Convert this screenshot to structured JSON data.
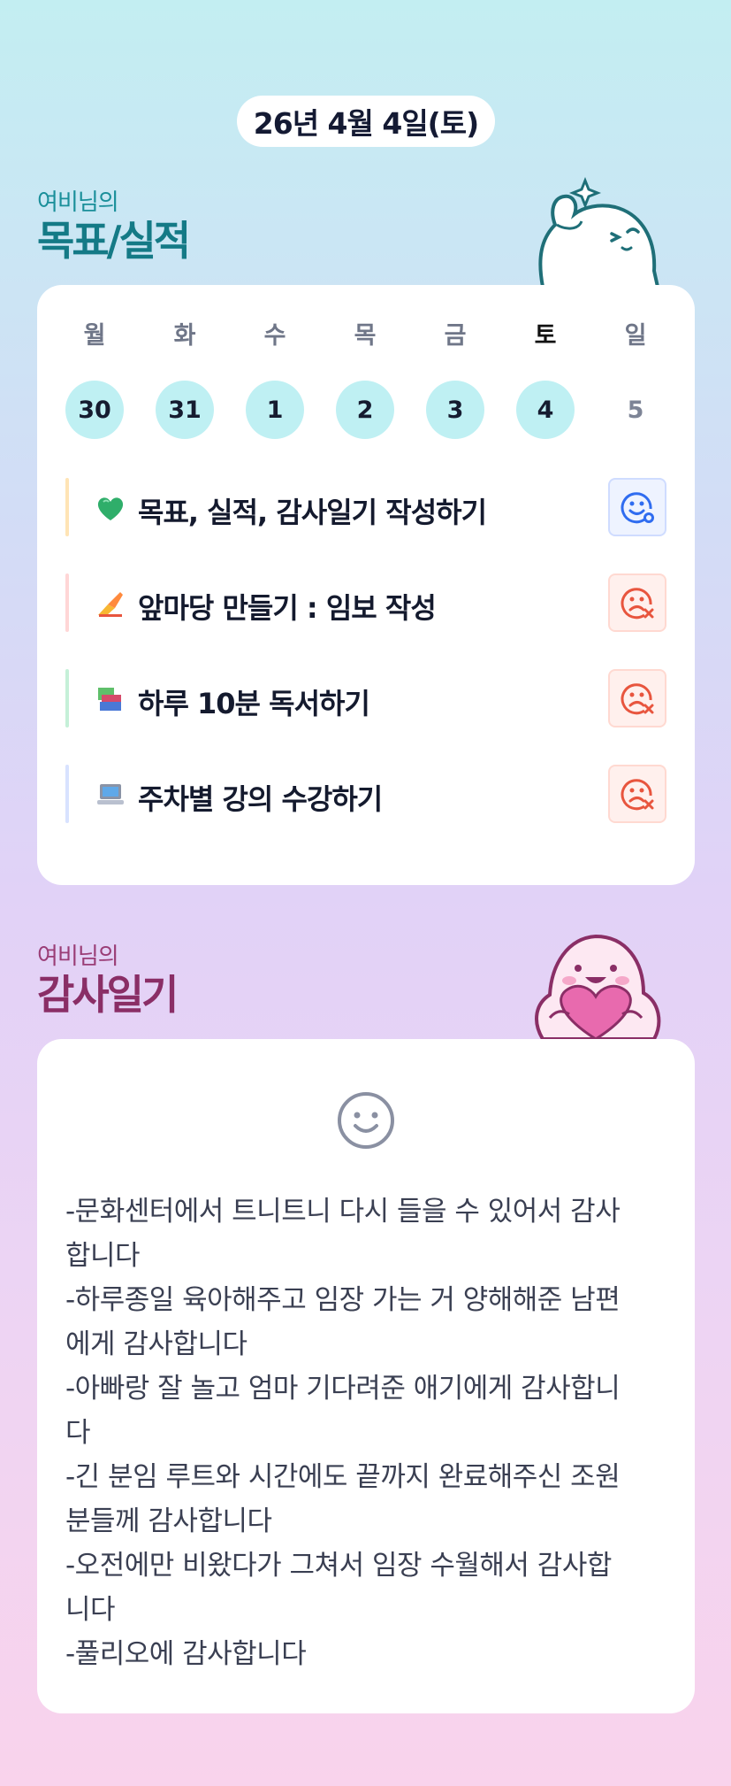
{
  "date": "26년 4월 4일(토)",
  "goals_section": {
    "owner": "여비님의",
    "title": "목표/실적"
  },
  "week": [
    {
      "label": "월",
      "num": "30",
      "state": "done"
    },
    {
      "label": "화",
      "num": "31",
      "state": "done"
    },
    {
      "label": "수",
      "num": "1",
      "state": "done"
    },
    {
      "label": "목",
      "num": "2",
      "state": "done"
    },
    {
      "label": "금",
      "num": "3",
      "state": "done"
    },
    {
      "label": "토",
      "num": "4",
      "state": "today"
    },
    {
      "label": "일",
      "num": "5",
      "state": "future"
    }
  ],
  "goals": [
    {
      "emoji": "green-heart-icon",
      "text": "목표, 실적, 감사일기 작성하기",
      "bar_color": "#ffe4b5",
      "status": "done"
    },
    {
      "emoji": "writing-hand-icon",
      "text": "앞마당 만들기 : 임보 작성",
      "bar_color": "#ffd6d6",
      "status": "missed"
    },
    {
      "emoji": "books-icon",
      "text": "하루 10분 독서하기",
      "bar_color": "#c5f0d8",
      "status": "missed"
    },
    {
      "emoji": "laptop-icon",
      "text": "주차별 강의 수강하기",
      "bar_color": "#d8e2ff",
      "status": "missed"
    }
  ],
  "gratitude_section": {
    "owner": "여비님의",
    "title": "감사일기"
  },
  "gratitude_lines": [
    "-문화센터에서 트니트니 다시 들을 수 있어서 감사",
    "합니다",
    "-하루종일 육아해주고 임장 가는 거 양해해준 남편",
    "에게 감사합니다",
    "-아빠랑 잘 놀고 엄마 기다려준 애기에게 감사합니",
    "다",
    "-긴 분임 루트와 시간에도 끝까지 완료해주신 조원",
    "분들께 감사합니다",
    "-오전에만 비왔다가 그쳐서 임장 수월해서 감사합",
    "니다",
    "-풀리오에 감사합니다"
  ],
  "colors": {
    "teal_accent": "#1a8f9a",
    "plum_accent": "#9a3d76",
    "done_circle": "#bff0f3",
    "ok_blue": "#2f6cf0",
    "fail_red": "#e8553e"
  }
}
